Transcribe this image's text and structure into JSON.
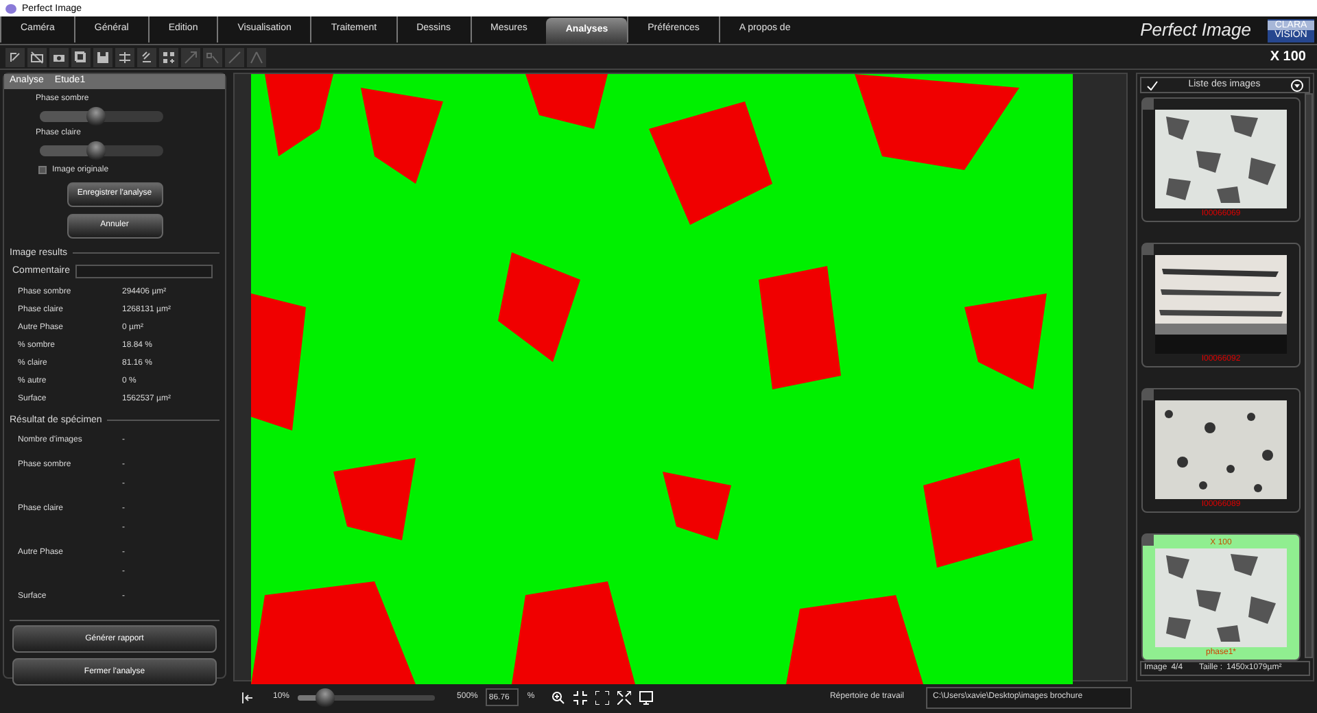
{
  "window": {
    "title": "Perfect Image"
  },
  "tabs": [
    {
      "label": "Caméra",
      "selected": false
    },
    {
      "label": "Général",
      "selected": false
    },
    {
      "label": "Edition",
      "selected": false
    },
    {
      "label": "Visualisation",
      "selected": false
    },
    {
      "label": "Traitement",
      "selected": false
    },
    {
      "label": "Dessins",
      "selected": false
    },
    {
      "label": "Mesures",
      "selected": false
    },
    {
      "label": "Analyses",
      "selected": true
    },
    {
      "label": "Préférences",
      "selected": false
    },
    {
      "label": "A propos de",
      "selected": false
    }
  ],
  "brand": {
    "name": "Perfect Image",
    "logo_top": "CLARA",
    "logo_bottom": "VISION"
  },
  "magnification": "X 100",
  "analysis_panel": {
    "title": "Analyse",
    "study": "Etude1",
    "sliders": [
      {
        "label": "Phase sombre",
        "level": 0.45
      },
      {
        "label": "Phase claire",
        "level": 0.45
      }
    ],
    "original_image": {
      "label": "Image originale",
      "checked": false
    },
    "buttons": [
      "Enregistrer l'analyse",
      "Annuler"
    ],
    "image_results": {
      "title": "Image results",
      "comment_label": "Commentaire",
      "rows": [
        {
          "label": "Phase sombre",
          "value": "294406 µm²"
        },
        {
          "label": "Phase claire",
          "value": "1268131 µm²"
        },
        {
          "label": "Autre Phase",
          "value": "0 µm²"
        },
        {
          "label": "% sombre",
          "value": "18.84 %"
        },
        {
          "label": "% claire",
          "value": "81.16 %"
        },
        {
          "label": "% autre",
          "value": "0 %"
        },
        {
          "label": "Surface",
          "value": "1562537 µm²"
        }
      ]
    },
    "specimen_results": {
      "title": "Résultat de spécimen",
      "rows": [
        {
          "label": "Nombre d'images",
          "values": [
            "-"
          ]
        },
        {
          "label": "Phase sombre",
          "values": [
            "-",
            "-"
          ]
        },
        {
          "label": "Phase claire",
          "values": [
            "-",
            "-"
          ]
        },
        {
          "label": "Autre Phase",
          "values": [
            "-",
            "-"
          ]
        },
        {
          "label": "Surface",
          "values": [
            "-"
          ]
        }
      ]
    },
    "footer_buttons": [
      "Générer rapport",
      "Fermer l'analyse"
    ]
  },
  "image_list": {
    "title": "Liste des images",
    "items": [
      {
        "caption": "I00066069",
        "selected": false,
        "kind": "blobs"
      },
      {
        "caption": "I00066092",
        "selected": false,
        "kind": "dense"
      },
      {
        "caption": "I00066089",
        "selected": false,
        "kind": "speckle"
      },
      {
        "caption": "phase1*",
        "selected": true,
        "top_label": "X 100",
        "kind": "blobs"
      }
    ],
    "image_count_label": "Image",
    "image_count": "4/4",
    "size_label": "Taille :",
    "size": "1450x1079µm²"
  },
  "zoom_bar": {
    "min": "10%",
    "level": 0.2,
    "max": "500%",
    "value": "86.76",
    "unit": "%"
  },
  "working_directory": {
    "label": "Répertoire de travail",
    "path": "C:\\Users\\xavie\\Desktop\\images brochure"
  }
}
